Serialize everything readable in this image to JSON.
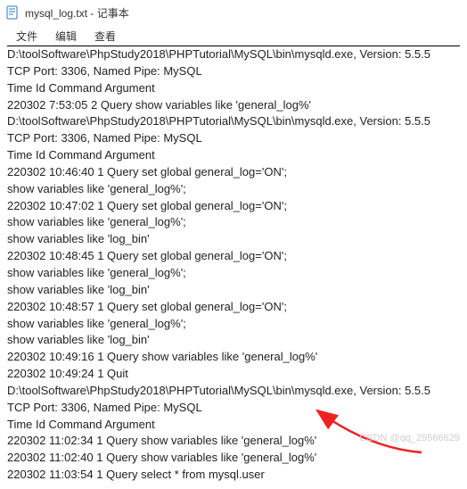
{
  "titlebar": {
    "text": "mysql_log.txt - 记事本"
  },
  "menubar": {
    "file": "文件",
    "edit": "编辑",
    "view": "查看"
  },
  "content": {
    "lines": [
      "D:\\toolSoftware\\PhpStudy2018\\PHPTutorial\\MySQL\\bin\\mysqld.exe, Version: 5.5.5",
      "TCP Port: 3306, Named Pipe: MySQL",
      "Time                 Id Command    Argument",
      "220302  7:53:05\t    2 Query\tshow variables like 'general_log%'",
      "D:\\toolSoftware\\PhpStudy2018\\PHPTutorial\\MySQL\\bin\\mysqld.exe, Version: 5.5.5",
      "TCP Port: 3306, Named Pipe: MySQL",
      "Time                 Id Command    Argument",
      "220302 10:46:40\t    1 Query\tset global general_log='ON';",
      "show variables like 'general_log%';",
      "220302 10:47:02\t    1 Query\tset global general_log='ON';",
      "show variables like 'general_log%';",
      "show variables like 'log_bin'",
      "220302 10:48:45\t    1 Query\tset global general_log='ON';",
      "show variables like 'general_log%';",
      "show variables like 'log_bin'",
      "220302 10:48:57\t    1 Query\tset global general_log='ON';",
      "show variables like 'general_log%';",
      "show variables like 'log_bin'",
      "220302 10:49:16\t    1 Query\tshow variables like 'general_log%'",
      "220302 10:49:24\t    1 Quit\t",
      "D:\\toolSoftware\\PhpStudy2018\\PHPTutorial\\MySQL\\bin\\mysqld.exe, Version: 5.5.5",
      "TCP Port: 3306, Named Pipe: MySQL",
      "Time                 Id Command    Argument",
      "220302 11:02:34\t    1 Query\tshow variables like 'general_log%'",
      "220302 11:02:40\t    1 Query\tshow variables like 'general_log%'",
      "220302 11:03:54\t    1 Query\tselect * from mysql.user"
    ]
  },
  "watermark": "CSDN @qq_29566629"
}
